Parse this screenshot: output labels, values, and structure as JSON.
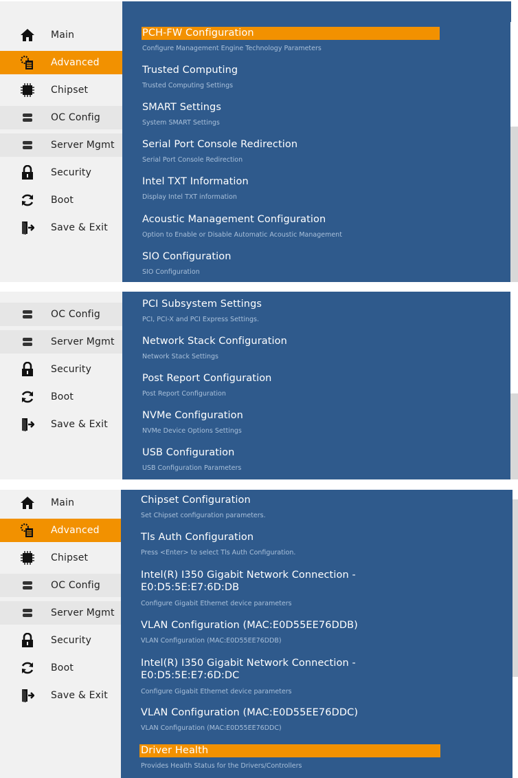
{
  "nav_items": [
    {
      "key": "main",
      "label": "Main",
      "icon": "home-icon"
    },
    {
      "key": "advanced",
      "label": "Advanced",
      "icon": "advanced-icon"
    },
    {
      "key": "chipset",
      "label": "Chipset",
      "icon": "chip-icon"
    },
    {
      "key": "oc_config",
      "label": "OC Config",
      "icon": "server-icon"
    },
    {
      "key": "server_mgmt",
      "label": "Server Mgmt",
      "icon": "server-icon"
    },
    {
      "key": "security",
      "label": "Security",
      "icon": "lock-icon"
    },
    {
      "key": "boot",
      "label": "Boot",
      "icon": "refresh-icon"
    },
    {
      "key": "save_exit",
      "label": "Save & Exit",
      "icon": "exit-icon"
    }
  ],
  "colors": {
    "accent": "#f29100",
    "content_bg": "#2f5a8c",
    "sidebar_bg": "#f1f1f1"
  },
  "panel1": {
    "selected_index": 0,
    "items": [
      {
        "title": "PCH-FW Configuration",
        "desc": "Configure Management Engine Technology Parameters"
      },
      {
        "title": "Trusted Computing",
        "desc": "Trusted Computing Settings"
      },
      {
        "title": "SMART Settings",
        "desc": "System SMART Settings"
      },
      {
        "title": "Serial Port Console Redirection",
        "desc": "Serial Port Console Redirection"
      },
      {
        "title": "Intel TXT Information",
        "desc": "Display Intel TXT information"
      },
      {
        "title": "Acoustic Management Configuration",
        "desc": "Option to Enable or Disable Automatic Acoustic Management"
      },
      {
        "title": "SIO Configuration",
        "desc": "SIO Configuration"
      }
    ]
  },
  "panel2": {
    "items": [
      {
        "title": "PCI Subsystem Settings",
        "desc": "PCI, PCI-X and PCI Express Settings."
      },
      {
        "title": "Network Stack Configuration",
        "desc": "Network Stack Settings"
      },
      {
        "title": "Post Report Configuration",
        "desc": "Post Report Configuration"
      },
      {
        "title": "NVMe Configuration",
        "desc": "NVMe Device Options Settings"
      },
      {
        "title": "USB Configuration",
        "desc": "USB Configuration Parameters"
      }
    ]
  },
  "panel3": {
    "selected_index": 6,
    "items": [
      {
        "title": "Chipset Configuration",
        "desc": "Set Chipset configuration parameters."
      },
      {
        "title": "Tls Auth Configuration",
        "desc": "Press <Enter> to select Tls Auth Configuration."
      },
      {
        "title": "Intel(R) I350 Gigabit Network Connection -",
        "title2": "E0:D5:5E:E7:6D:DB",
        "desc": "Configure Gigabit Ethernet device parameters"
      },
      {
        "title": "VLAN Configuration (MAC:E0D55EE76DDB)",
        "desc": "VLAN Configuration (MAC:E0D55EE76DDB)"
      },
      {
        "title": "Intel(R) I350 Gigabit Network Connection -",
        "title2": "E0:D5:5E:E7:6D:DC",
        "desc": "Configure Gigabit Ethernet device parameters"
      },
      {
        "title": "VLAN Configuration (MAC:E0D55EE76DDC)",
        "desc": "VLAN Configuration (MAC:E0D55EE76DDC)"
      },
      {
        "title": "Driver Health",
        "desc": "Provides Health Status for the Drivers/Controllers"
      }
    ]
  }
}
